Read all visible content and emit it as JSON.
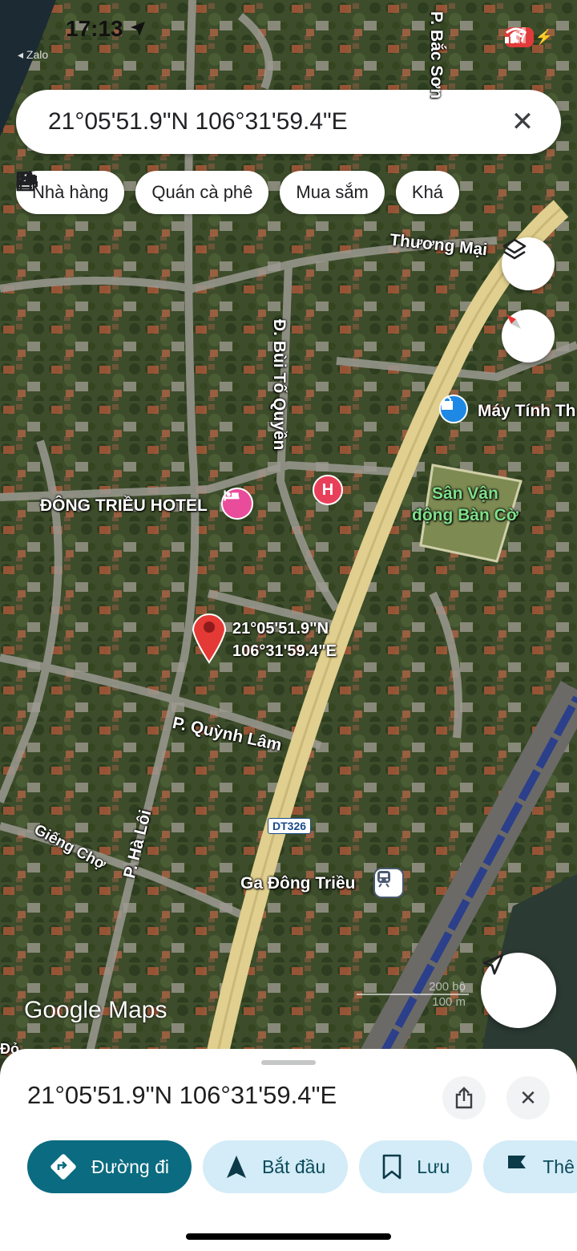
{
  "status_bar": {
    "time": "17:13",
    "back_app": "◂ Zalo",
    "battery": "17"
  },
  "search": {
    "value": "21°05'51.9\"N 106°31'59.4\"E"
  },
  "chips": [
    {
      "icon": "restaurant-icon",
      "label": "Nhà hàng"
    },
    {
      "icon": "cafe-icon",
      "label": "Quán cà phê"
    },
    {
      "icon": "shopping-bag-icon",
      "label": "Mua sắm"
    },
    {
      "icon": "hotel-icon",
      "label": "Khá"
    }
  ],
  "map": {
    "streets": {
      "bac_son": "P. Bắc Sơn",
      "thuong_mai": "Thương Mại",
      "bui_to_quyen": "Đ. Bùi Tố Quyền",
      "quynh_lam": "P. Quỳnh Lâm",
      "ha_loi": "P. Hà Lôi",
      "gieng_cho": "Giếng Chợ",
      "dt326": "DT326",
      "edge_text": "Đỏ"
    },
    "pois": {
      "hotel": "ĐÔNG TRIỀU HOTEL",
      "computer_shop": "Máy Tính Th",
      "stadium": "Sân Vận\nđộng Bàn Cờ",
      "station": "Ga Đông Triều",
      "hospital_letter": "H"
    },
    "pin": {
      "line1": "21°05'51.9\"N",
      "line2": "106°31'59.4\"E"
    },
    "watermark": {
      "brand": "Google",
      "product": "Maps"
    },
    "scale": {
      "feet": "200 bộ",
      "meters": "100 m"
    }
  },
  "sheet": {
    "title": "21°05'51.9\"N 106°31'59.4\"E",
    "actions": [
      {
        "icon": "directions-icon",
        "label": "Đường đi"
      },
      {
        "icon": "navigation-arrow-icon",
        "label": "Bắt đầu"
      },
      {
        "icon": "bookmark-icon",
        "label": "Lưu"
      },
      {
        "icon": "flag-icon",
        "label": "Thê"
      }
    ]
  },
  "colors": {
    "accent": "#0b6b80",
    "pin": "#e53935",
    "road": "#e0cf8e",
    "satellite": "#3b4a2c"
  }
}
